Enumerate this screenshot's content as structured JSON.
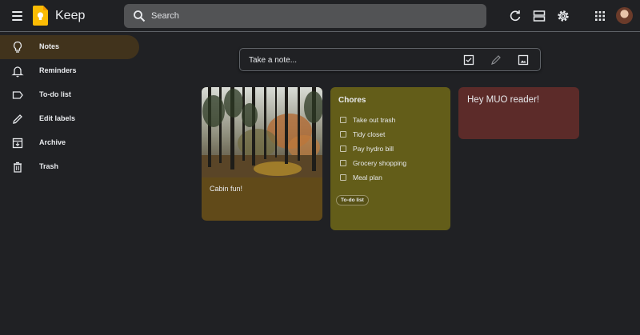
{
  "header": {
    "app_title": "Keep",
    "search": {
      "placeholder": "Search",
      "value": ""
    }
  },
  "sidebar": {
    "items": [
      {
        "label": "Notes",
        "icon": "lightbulb-icon",
        "active": true
      },
      {
        "label": "Reminders",
        "icon": "bell-icon"
      },
      {
        "label": "To-do list",
        "icon": "label-icon"
      },
      {
        "label": "Edit labels",
        "icon": "pencil-icon"
      },
      {
        "label": "Archive",
        "icon": "archive-icon"
      },
      {
        "label": "Trash",
        "icon": "trash-icon"
      }
    ]
  },
  "take_note": {
    "placeholder": "Take a note..."
  },
  "notes": {
    "cabin": {
      "text": "Cabin fun!"
    },
    "chores": {
      "title": "Chores",
      "items": [
        "Take out trash",
        "Tidy closet",
        "Pay hydro bill",
        "Grocery shopping",
        "Meal plan"
      ],
      "label": "To-do list"
    },
    "muo": {
      "text": "Hey MUO reader!"
    }
  },
  "colors": {
    "background": "#202124",
    "active_nav": "#41331c",
    "search_bg": "#525355",
    "note_brown": "#614a19",
    "note_olive": "#635d19",
    "note_red": "#5c2b29"
  }
}
